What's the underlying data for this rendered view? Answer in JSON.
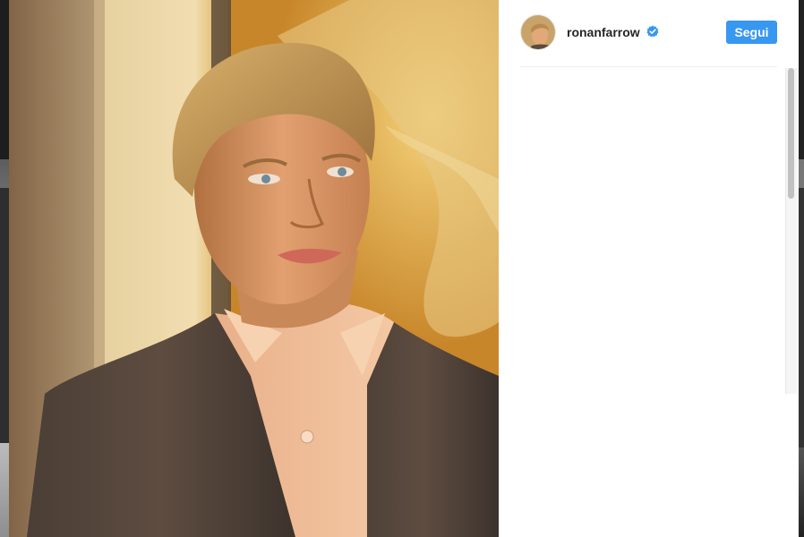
{
  "post": {
    "username": "ronanfarrow",
    "follow_label": "Segui",
    "verified": true
  },
  "colors": {
    "accent": "#3897f0",
    "verified_badge": "#3897f0"
  },
  "icons": {
    "verified": "verified-badge-icon"
  }
}
